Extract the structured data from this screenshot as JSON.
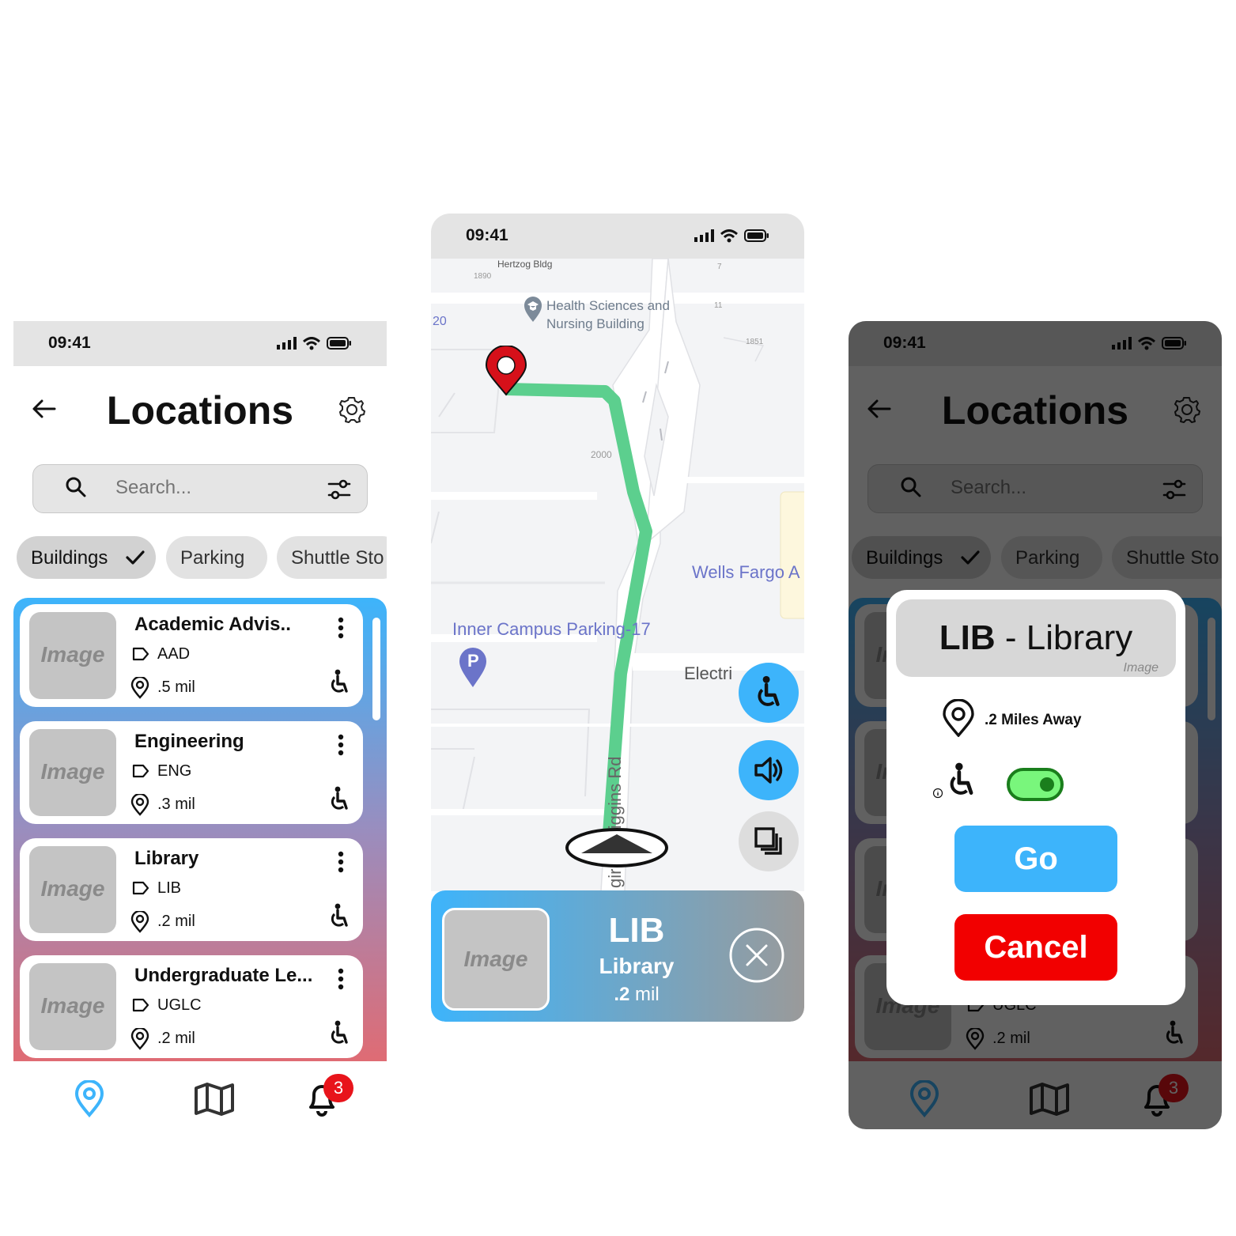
{
  "status_bar": {
    "time": "09:41"
  },
  "screen1": {
    "title": "Locations",
    "search": {
      "placeholder": "Search..."
    },
    "chips": [
      {
        "label": "Buildings",
        "selected": true
      },
      {
        "label": "Parking"
      },
      {
        "label": "Shuttle Sto"
      }
    ],
    "locations": [
      {
        "image_label": "Image",
        "name": "Academic Advis..",
        "code": "AAD",
        "distance": ".5 mil"
      },
      {
        "image_label": "Image",
        "name": "Engineering",
        "code": "ENG",
        "distance": ".3 mil"
      },
      {
        "image_label": "Image",
        "name": "Library",
        "code": "LIB",
        "distance": ".2 mil"
      },
      {
        "image_label": "Image",
        "name": "Undergraduate Le...",
        "code": "UGLC",
        "distance": ".2 mil"
      }
    ],
    "notification_count": "3"
  },
  "screen2": {
    "map_labels": {
      "hertzog": "Hertzog Bldg",
      "n1890": "1890",
      "n7": "7",
      "n20": "20",
      "health_sciences_1": "Health Sciences and",
      "health_sciences_2": "Nursing Building",
      "n11": "11",
      "n1851": "1851",
      "n2000": "2000",
      "wells_fargo": "Wells Fargo A",
      "inner_campus": "Inner Campus Parking-17",
      "electri": "Electri",
      "wiggins": "Wiggins Rd",
      "gir": "gir",
      "parking_marker": "P"
    },
    "destination": {
      "image_label": "Image",
      "code": "LIB",
      "name": "Library",
      "distance_num": ".2",
      "distance_unit": " mil"
    }
  },
  "screen3": {
    "modal": {
      "code": "LIB",
      "separator": " - ",
      "name": "Library",
      "image_label": "Image",
      "distance": ".2 Miles Away",
      "accessible_route_enabled": true,
      "go_label": "Go",
      "cancel_label": "Cancel"
    }
  },
  "colors": {
    "accent": "#3db4fb",
    "route": "#5ccf8e",
    "cancel": "#f20000",
    "toggle_on": "#79f67c",
    "badge": "#e8141b"
  },
  "icons": [
    "back-arrow-icon",
    "gear-icon",
    "search-icon",
    "filter-icon",
    "check-icon",
    "tag-icon",
    "location-pin-icon",
    "wheelchair-icon",
    "more-vertical-icon",
    "map-icon",
    "bell-icon",
    "volume-icon",
    "layers-icon",
    "close-circle-icon",
    "navigation-arrow-icon",
    "info-icon"
  ]
}
